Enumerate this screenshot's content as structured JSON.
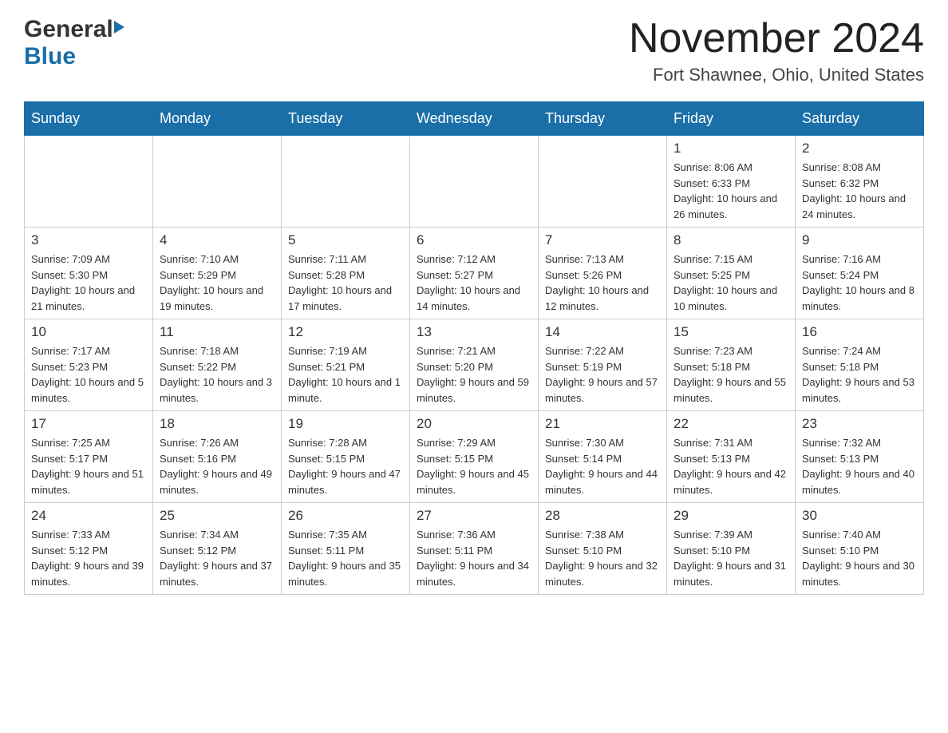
{
  "header": {
    "logo_general": "General",
    "logo_blue": "Blue",
    "month_year": "November 2024",
    "location": "Fort Shawnee, Ohio, United States"
  },
  "weekdays": [
    "Sunday",
    "Monday",
    "Tuesday",
    "Wednesday",
    "Thursday",
    "Friday",
    "Saturday"
  ],
  "weeks": [
    [
      {
        "day": "",
        "info": ""
      },
      {
        "day": "",
        "info": ""
      },
      {
        "day": "",
        "info": ""
      },
      {
        "day": "",
        "info": ""
      },
      {
        "day": "",
        "info": ""
      },
      {
        "day": "1",
        "info": "Sunrise: 8:06 AM\nSunset: 6:33 PM\nDaylight: 10 hours and 26 minutes."
      },
      {
        "day": "2",
        "info": "Sunrise: 8:08 AM\nSunset: 6:32 PM\nDaylight: 10 hours and 24 minutes."
      }
    ],
    [
      {
        "day": "3",
        "info": "Sunrise: 7:09 AM\nSunset: 5:30 PM\nDaylight: 10 hours and 21 minutes."
      },
      {
        "day": "4",
        "info": "Sunrise: 7:10 AM\nSunset: 5:29 PM\nDaylight: 10 hours and 19 minutes."
      },
      {
        "day": "5",
        "info": "Sunrise: 7:11 AM\nSunset: 5:28 PM\nDaylight: 10 hours and 17 minutes."
      },
      {
        "day": "6",
        "info": "Sunrise: 7:12 AM\nSunset: 5:27 PM\nDaylight: 10 hours and 14 minutes."
      },
      {
        "day": "7",
        "info": "Sunrise: 7:13 AM\nSunset: 5:26 PM\nDaylight: 10 hours and 12 minutes."
      },
      {
        "day": "8",
        "info": "Sunrise: 7:15 AM\nSunset: 5:25 PM\nDaylight: 10 hours and 10 minutes."
      },
      {
        "day": "9",
        "info": "Sunrise: 7:16 AM\nSunset: 5:24 PM\nDaylight: 10 hours and 8 minutes."
      }
    ],
    [
      {
        "day": "10",
        "info": "Sunrise: 7:17 AM\nSunset: 5:23 PM\nDaylight: 10 hours and 5 minutes."
      },
      {
        "day": "11",
        "info": "Sunrise: 7:18 AM\nSunset: 5:22 PM\nDaylight: 10 hours and 3 minutes."
      },
      {
        "day": "12",
        "info": "Sunrise: 7:19 AM\nSunset: 5:21 PM\nDaylight: 10 hours and 1 minute."
      },
      {
        "day": "13",
        "info": "Sunrise: 7:21 AM\nSunset: 5:20 PM\nDaylight: 9 hours and 59 minutes."
      },
      {
        "day": "14",
        "info": "Sunrise: 7:22 AM\nSunset: 5:19 PM\nDaylight: 9 hours and 57 minutes."
      },
      {
        "day": "15",
        "info": "Sunrise: 7:23 AM\nSunset: 5:18 PM\nDaylight: 9 hours and 55 minutes."
      },
      {
        "day": "16",
        "info": "Sunrise: 7:24 AM\nSunset: 5:18 PM\nDaylight: 9 hours and 53 minutes."
      }
    ],
    [
      {
        "day": "17",
        "info": "Sunrise: 7:25 AM\nSunset: 5:17 PM\nDaylight: 9 hours and 51 minutes."
      },
      {
        "day": "18",
        "info": "Sunrise: 7:26 AM\nSunset: 5:16 PM\nDaylight: 9 hours and 49 minutes."
      },
      {
        "day": "19",
        "info": "Sunrise: 7:28 AM\nSunset: 5:15 PM\nDaylight: 9 hours and 47 minutes."
      },
      {
        "day": "20",
        "info": "Sunrise: 7:29 AM\nSunset: 5:15 PM\nDaylight: 9 hours and 45 minutes."
      },
      {
        "day": "21",
        "info": "Sunrise: 7:30 AM\nSunset: 5:14 PM\nDaylight: 9 hours and 44 minutes."
      },
      {
        "day": "22",
        "info": "Sunrise: 7:31 AM\nSunset: 5:13 PM\nDaylight: 9 hours and 42 minutes."
      },
      {
        "day": "23",
        "info": "Sunrise: 7:32 AM\nSunset: 5:13 PM\nDaylight: 9 hours and 40 minutes."
      }
    ],
    [
      {
        "day": "24",
        "info": "Sunrise: 7:33 AM\nSunset: 5:12 PM\nDaylight: 9 hours and 39 minutes."
      },
      {
        "day": "25",
        "info": "Sunrise: 7:34 AM\nSunset: 5:12 PM\nDaylight: 9 hours and 37 minutes."
      },
      {
        "day": "26",
        "info": "Sunrise: 7:35 AM\nSunset: 5:11 PM\nDaylight: 9 hours and 35 minutes."
      },
      {
        "day": "27",
        "info": "Sunrise: 7:36 AM\nSunset: 5:11 PM\nDaylight: 9 hours and 34 minutes."
      },
      {
        "day": "28",
        "info": "Sunrise: 7:38 AM\nSunset: 5:10 PM\nDaylight: 9 hours and 32 minutes."
      },
      {
        "day": "29",
        "info": "Sunrise: 7:39 AM\nSunset: 5:10 PM\nDaylight: 9 hours and 31 minutes."
      },
      {
        "day": "30",
        "info": "Sunrise: 7:40 AM\nSunset: 5:10 PM\nDaylight: 9 hours and 30 minutes."
      }
    ]
  ]
}
